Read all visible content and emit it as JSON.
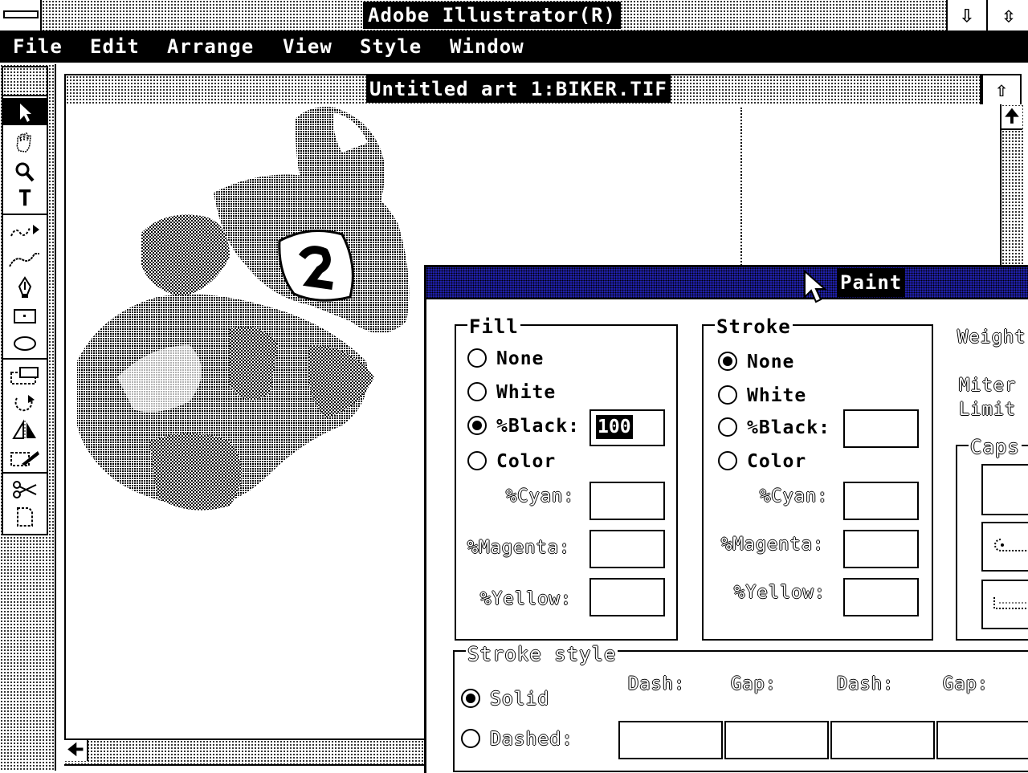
{
  "app": {
    "title": "Adobe Illustrator(R)",
    "minimize_glyph": "⇩",
    "maximize_glyph": "⇳"
  },
  "menu": [
    "File",
    "Edit",
    "Arrange",
    "View",
    "Style",
    "Window"
  ],
  "document": {
    "title": "Untitled art 1:BIKER.TIF"
  },
  "tools": {
    "selection": "arrow-icon",
    "hand": "hand-icon",
    "zoom": "zoom-icon",
    "type": "T",
    "freehand": "freehand-icon",
    "blend": "blend-icon",
    "pen": "pen-icon",
    "rectangle": "rectangle-icon",
    "oval": "oval-icon",
    "scale": "scale-icon",
    "rotate": "rotate-icon",
    "reflect": "reflect-icon",
    "shear": "shear-icon",
    "scissors": "scissors-icon",
    "page": "page-icon"
  },
  "paint": {
    "title": "Paint",
    "fill": {
      "label": "Fill",
      "none": "None",
      "white": "White",
      "black": "%Black:",
      "black_value": "100",
      "color": "Color",
      "selected": "black",
      "cyan": "%Cyan:",
      "magenta": "%Magenta:",
      "yellow": "%Yellow:"
    },
    "stroke": {
      "label": "Stroke",
      "none": "None",
      "white": "White",
      "black": "%Black:",
      "color": "Color",
      "selected": "none",
      "cyan": "%Cyan:",
      "magenta": "%Magenta:",
      "yellow": "%Yellow:"
    },
    "weight_label": "Weight",
    "miter_label_1": "Miter",
    "miter_label_2": "Limit",
    "caps_label": "Caps",
    "stroke_style": {
      "label": "Stroke style",
      "solid": "Solid",
      "dashed": "Dashed:",
      "selected": "solid",
      "dash1": "Dash:",
      "gap1": "Gap:",
      "dash2": "Dash:",
      "gap2": "Gap:"
    }
  }
}
